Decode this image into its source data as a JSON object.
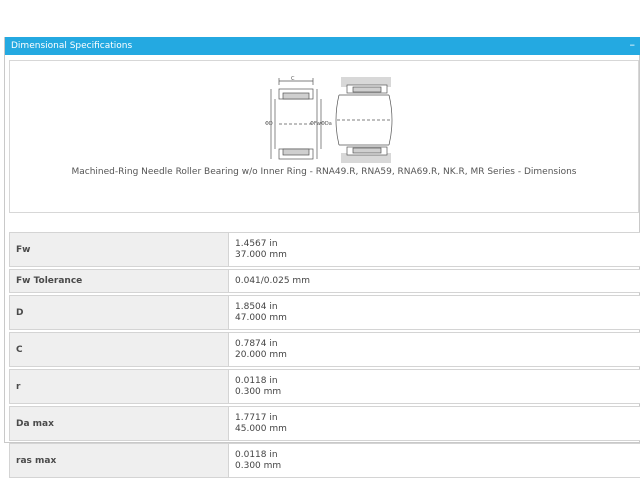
{
  "panel": {
    "title": "Dimensional Specifications",
    "collapse_glyph": "–"
  },
  "figure": {
    "caption": "Machined-Ring Needle Roller Bearing w/o Inner Ring - RNA49.R, RNA59, RNA69.R, NK.R, MR Series - Dimensions",
    "label_c": "C",
    "label_d": "ΦD",
    "label_fw": "ΦFw",
    "label_da": "ΦDa",
    "icon": "bearing-cross-section-diagram"
  },
  "specs": [
    {
      "label": "Fw",
      "line1": "1.4567 in",
      "line2": "37.000 mm"
    },
    {
      "label": "Fw Tolerance",
      "line1": "0.041/0.025 mm",
      "line2": ""
    },
    {
      "label": "D",
      "line1": "1.8504 in",
      "line2": "47.000 mm"
    },
    {
      "label": "C",
      "line1": "0.7874 in",
      "line2": "20.000 mm"
    },
    {
      "label": "r",
      "line1": "0.0118 in",
      "line2": "0.300 mm"
    },
    {
      "label": "Da max",
      "line1": "1.7717 in",
      "line2": "45.000 mm"
    },
    {
      "label": "ras max",
      "line1": "0.0118 in",
      "line2": "0.300 mm"
    }
  ]
}
